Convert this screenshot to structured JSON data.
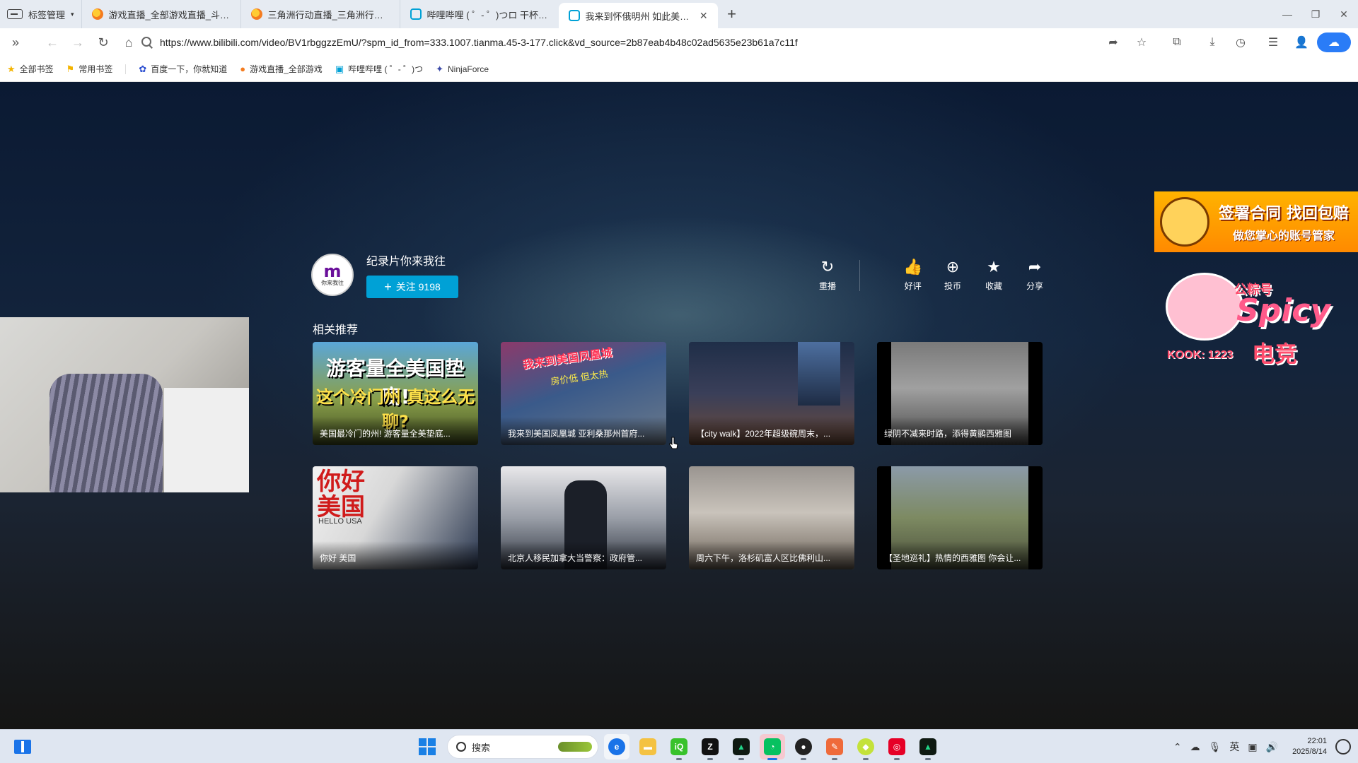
{
  "browser": {
    "tab_manager_label": "标签管理",
    "tabs": [
      {
        "title": "游戏直播_全部游戏直播_斗鱼直播",
        "icon": "douyu-favicon"
      },
      {
        "title": "三角洲行动直播_三角洲行动直播",
        "icon": "douyu-favicon"
      },
      {
        "title": "哔哩哔哩 ( ゜- ゜)つロ 干杯~-bilibili",
        "icon": "bilibili-favicon"
      },
      {
        "title": "我来到怀俄明州 如此美丽 为什",
        "icon": "bilibili-favicon",
        "active": true
      }
    ],
    "new_tab_symbol": "+",
    "url": "https://www.bilibili.com/video/BV1rbggzzEmU/?spm_id_from=333.1007.tianma.45-3-177.click&vd_source=2b87eab4b48c02ad5635e23b61a7c11f",
    "bookmarks": [
      {
        "label": "全部书签",
        "icon": "star-icon"
      },
      {
        "label": "常用书签",
        "icon": "bookmark-flag-icon"
      },
      {
        "label": "百度一下，你就知道",
        "icon": "baidu-paw-icon"
      },
      {
        "label": "游戏直播_全部游戏",
        "icon": "douyu-favicon"
      },
      {
        "label": "哔哩哔哩 ( ゜- ゜)つ",
        "icon": "bilibili-favicon"
      },
      {
        "label": "NinjaForce",
        "icon": "ninjaforce-icon"
      }
    ]
  },
  "player_end": {
    "author": {
      "name": "纪录片你来我往",
      "avatar_caption": "你来我往",
      "avatar_letter": "m"
    },
    "follow_button": {
      "label": "关注 9198",
      "plus": "+"
    },
    "actions": [
      {
        "label": "重播",
        "icon": "replay-icon",
        "glyph": "↻"
      },
      {
        "label": "好评",
        "icon": "thumbs-up-icon",
        "glyph": "👍"
      },
      {
        "label": "投币",
        "icon": "coin-icon",
        "glyph": "⊕"
      },
      {
        "label": "收藏",
        "icon": "star-icon",
        "glyph": "★"
      },
      {
        "label": "分享",
        "icon": "share-icon",
        "glyph": "➦"
      }
    ],
    "related_title": "相关推荐",
    "related": [
      {
        "title": "美国最冷门的州! 游客量全美垫底...",
        "overlay_line1": "游客量全美国垫底!",
        "overlay_line2": "这个冷门州 真这么无聊?"
      },
      {
        "title": "我来到美国凤凰城 亚利桑那州首府...",
        "overlay_line1": "我来到美国凤凰城",
        "overlay_line2": "房价低 但太热"
      },
      {
        "title": "【city walk】2022年超级碗周末，...",
        "overlay_line1": "",
        "overlay_line2": ""
      },
      {
        "title": "绿阴不减来时路，添得黄鹂西雅图",
        "overlay_line1": "",
        "overlay_line2": ""
      },
      {
        "title": "你好 美国",
        "overlay_line1": "你好美国",
        "overlay_line2": "HELLO USA"
      },
      {
        "title": "北京人移民加拿大当警察：政府管...",
        "overlay_line1": "",
        "overlay_line2": ""
      },
      {
        "title": "周六下午，洛杉矶富人区比佛利山...",
        "overlay_line1": "",
        "overlay_line2": ""
      },
      {
        "title": "【圣地巡礼】热情的西雅图 你会让...",
        "overlay_line1": "",
        "overlay_line2": ""
      }
    ]
  },
  "overlays": {
    "ad_line1": "签署合同 找回包赔",
    "ad_line2": "做您掌心的账号管家",
    "sticker_line1": "公粽号",
    "sticker_line2": "Spicy",
    "sticker_line3": "KOOK: 1223",
    "sticker_line4": "电竞"
  },
  "taskbar": {
    "search_placeholder": "搜索",
    "apps": [
      "edge-browser",
      "file-explorer",
      "iqiyi",
      "zed-editor",
      "pycharm",
      "wechat",
      "obs",
      "app-orange",
      "app-lime",
      "netease-music",
      "pycharm-2"
    ],
    "ime": "英",
    "time": "22:01",
    "date": "2025/8/14"
  },
  "colors": {
    "bilibili_blue": "#00a1d6",
    "tab_bar": "#e6ebf2",
    "page_bg": "#13243c"
  }
}
